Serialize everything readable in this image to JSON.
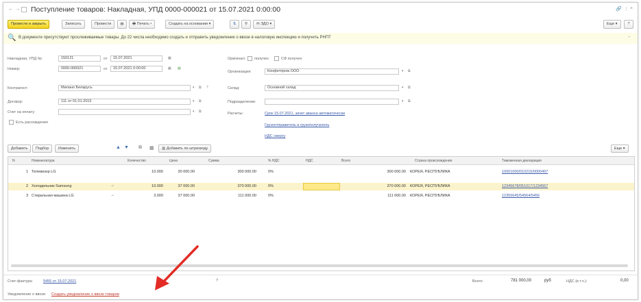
{
  "window": {
    "title": "Поступление товаров: Накладная, УПД 0000-000021 от 15.07.2021 0:00:00",
    "nav_back": "←",
    "nav_forward": "→",
    "link_icon": "🔗",
    "more_icon": "⋮",
    "close_icon": "×"
  },
  "toolbar": {
    "post_close": "Провести и закрыть",
    "save": "Записать",
    "post": "Провести",
    "print": "Печать",
    "create_basis": "Создать на основании",
    "edo": "ЭДО",
    "more": "Еще",
    "help": "?"
  },
  "info": {
    "text": "В документе присутствуют прослеживаемые товары. До 22 числа необходимо создать и отправить уведомление о ввозе в налоговую инспекцию и получить РНПТ"
  },
  "form": {
    "invoice_label": "Накладная, УПД №:",
    "invoice_value": "150121",
    "from1": "от",
    "invoice_date": "15.07.2021",
    "number_label": "Номер:",
    "number_value": "0000-000021",
    "from2": "от",
    "number_date": "15.07.2021 0:00:00",
    "original_label": "Оригинал:",
    "original_option": "получен",
    "sf_option": "СФ получен",
    "org_label": "Организация:",
    "org_value": "Конфетпром ООО",
    "counterparty_label": "Контрагент:",
    "counterparty_value": "Милано Беларусь",
    "warehouse_label": "Склад:",
    "warehouse_value": "Основной склад",
    "contract_label": "Договор:",
    "contract_value": "111 от 01.01.2015",
    "division_label": "Подразделение:",
    "division_value": "",
    "payment_acc_label": "Счет на оплату:",
    "payment_acc_value": "",
    "settlements_label": "Расчеты:",
    "settlements_link": "Срок 15.07.2021, зачет аванса автоматически",
    "shipper_link": "Грузоотправитель и грузополучатель",
    "vat_link": "НДС сверху",
    "discrepancy_label": "Есть расхождения"
  },
  "table_toolbar": {
    "add": "Добавить",
    "pick": "Подбор",
    "change": "Изменить",
    "barcode": "Добавить по штрихкоду",
    "more": "Еще"
  },
  "table": {
    "headers": [
      "N",
      "Номенклатура",
      "Количество",
      "Цена",
      "Сумма",
      "% НДС",
      "НДС",
      "Всего",
      "Страна происхождения",
      "Таможенная декларация"
    ],
    "rows": [
      {
        "n": "1",
        "name": "Телевизор LG",
        "qty": "10.000",
        "price": "30 000.00",
        "sum": "300 000.00",
        "vat_pct": "0%",
        "vat": "",
        "total": "300 000.00",
        "country": "КОРЕЯ, РЕСПУБЛИКА",
        "gtd": "10001000/010215/0000497",
        "selected": false
      },
      {
        "n": "2",
        "name": "Холодильник Samsung",
        "qty": "10.000",
        "price": "37 000.00",
        "sum": "370 000.00",
        "vat_pct": "0%",
        "vat": "",
        "total": "370 000.00",
        "country": "КОРЕЯ, РЕСПУБЛИКА",
        "gtd": "12345678/051017/1234567",
        "selected": true
      },
      {
        "n": "3",
        "name": "Стиральная машина LG",
        "qty": "3.000",
        "price": "37 000.00",
        "sum": "111 000.00",
        "vat_pct": "0%",
        "vat": "",
        "total": "111 000.00",
        "country": "КОРЕЯ, РЕСПУБЛИКА",
        "gtd": "12355645/54564/5456",
        "selected": false
      }
    ]
  },
  "footer": {
    "sf_label": "Счет-фактура:",
    "sf_link": "5455 от 15.07.2021",
    "question": "?",
    "notice_label": "Уведомление о ввозе:",
    "notice_link": "Создать уведомление о ввозе товаров",
    "total_label": "Всего:",
    "total_value": "781 000,00",
    "currency": "руб",
    "vat_label": "НДС (в т.ч.):",
    "vat_value": "0,00"
  },
  "colors": {
    "primary_button": "#f2d21e",
    "info_bg": "#fdfde6",
    "selected_row": "#fbf3cb",
    "link": "#3b5aa8",
    "arrow": "#e32c25"
  }
}
